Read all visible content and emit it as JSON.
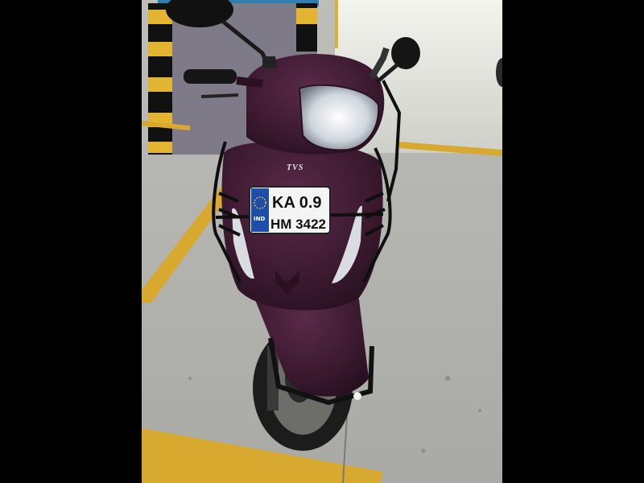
{
  "photo": {
    "brand": "TVS",
    "plate": {
      "country": "IND",
      "line1": "KA 0.9",
      "line2": "HM 3422"
    }
  }
}
